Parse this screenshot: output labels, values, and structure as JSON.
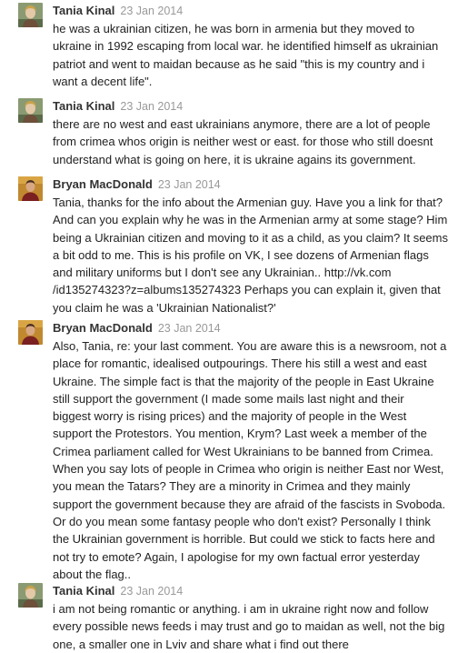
{
  "comments": [
    {
      "author": "Tania Kinal",
      "date": "23 Jan 2014",
      "avatar": "tania-avatar-icon",
      "lines": [
        "he was a ukrainian citizen, he was born in armenia but they moved to",
        "ukraine in 1992 escaping from local war. he identified himself as ukrainian",
        "patriot and went to maidan because as he said \"this is my country and i",
        "want a decent life\"."
      ]
    },
    {
      "author": "Tania Kinal",
      "date": "23 Jan 2014",
      "avatar": "tania-avatar-icon",
      "lines": [
        "there are no west and east ukrainians anymore, there are a lot of people",
        "from crimea whos origin is neither west or east. for those who still doesnt",
        "understand what is going on here, it is ukraine agains its government."
      ]
    },
    {
      "author": "Bryan MacDonald",
      "date": "23 Jan 2014",
      "avatar": "bryan-avatar-icon",
      "lines": [
        "Tania, thanks for the info about the Armenian guy. Have you a link for that?",
        "And can you explain why he was in the Armenian army at some stage? Him",
        "being a Ukrainian citizen and moving to it as a child, as you claim? It seems",
        "a bit odd to me. This is his profile on VK, I see dozens of Armenian flags",
        "and military uniforms but I don't see any Ukrainian.. http://vk.com",
        "/id135274323?z=albums135274323  Perhaps you can explain it, given that",
        "you claim he was a 'Ukrainian Nationalist?'"
      ]
    },
    {
      "author": "Bryan MacDonald",
      "date": "23 Jan 2014",
      "avatar": "bryan-avatar-icon",
      "lines": [
        "Also, Tania, re: your last comment. You are aware this is a newsroom, not a",
        "place for romantic, idealised outpourings. There his still a west and east",
        "Ukraine. The simple fact is that the majority of the people in East Ukraine",
        "still support the government (I made some mails last night and their",
        "biggest worry is rising prices) and the majority of people in the West",
        "support the Protestors. You mention, Krym? Last week a member of the",
        "Crimea parliament called for West Ukrainians to be banned from Crimea.",
        "When you say lots of people in Crimea who origin is neither East nor West,",
        "you mean the Tatars? They are a minority in Crimea and they mainly",
        "support the government because they are afraid of the fascists in Svoboda.",
        "Or do you mean some fantasy people who don't exist? Personally I think",
        "the Ukrainian government is horrible. But could we stick to facts here and",
        "not try to emote? Again, I apologise for my own factual error yesterday",
        "about the flag.."
      ]
    },
    {
      "author": "Tania Kinal",
      "date": "23 Jan 2014",
      "avatar": "tania-avatar-icon",
      "lines": [
        "i am not being romantic or anything. i am in ukraine right now and follow",
        "every possible news feeds i may trust and go to maidan as well, not the big",
        "one, a smaller one in Lviv and share what i find out there"
      ]
    }
  ]
}
